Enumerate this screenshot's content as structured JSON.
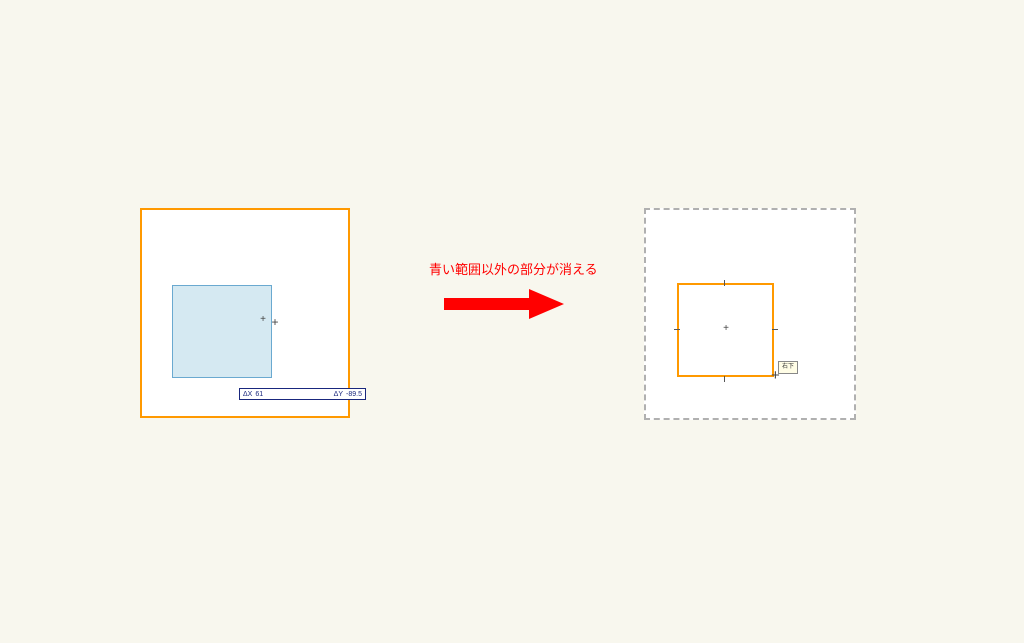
{
  "caption": "青い範囲以外の部分が消える",
  "coord_bar": {
    "dx_label": "ΔX",
    "dx_value": "61",
    "dy_label": "ΔY",
    "dy_value": "-89.5"
  },
  "tooltip": "右下",
  "colors": {
    "accent_orange": "#ff9900",
    "selection_blue_fill": "#d5e9f2",
    "selection_blue_border": "#6aa9d0",
    "caption_red": "#ff0000",
    "dashed_gray": "#b0b0b0",
    "coord_navy": "#19277d",
    "bg": "#f8f7ee"
  },
  "icons": {
    "crosshair": "plus-icon",
    "arrow": "arrow-right-icon"
  }
}
